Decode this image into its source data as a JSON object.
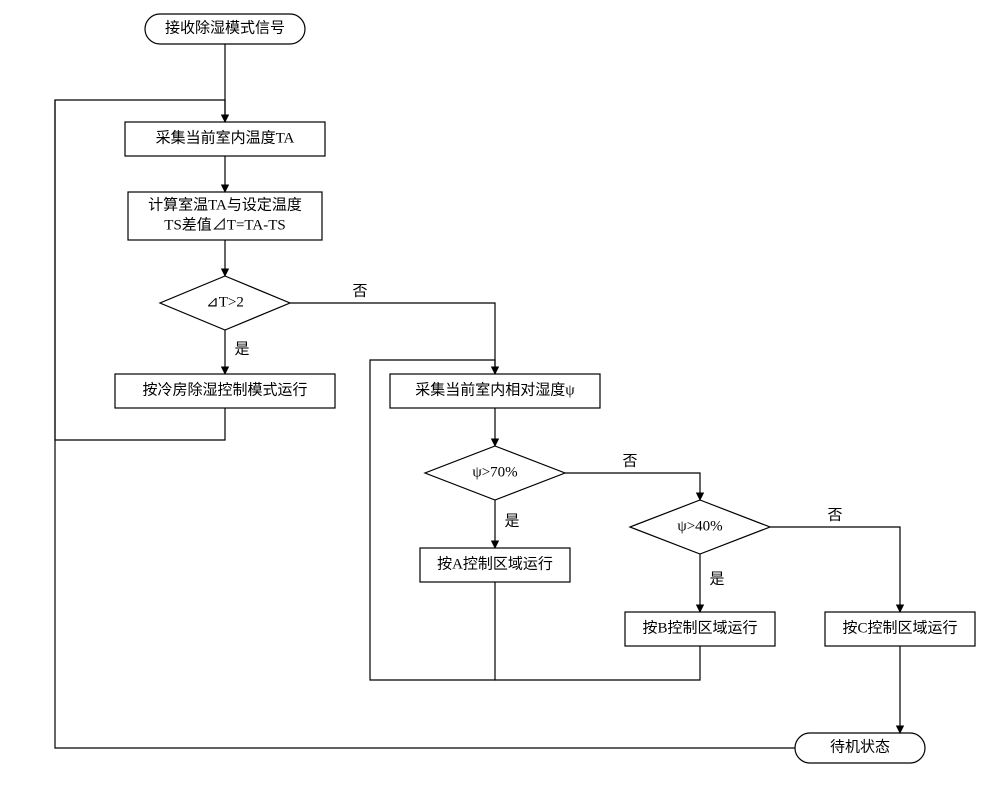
{
  "chart_data": {
    "type": "flowchart",
    "nodes": {
      "start": {
        "kind": "terminator",
        "label": "接收除湿模式信号"
      },
      "p1": {
        "kind": "process",
        "label": "采集当前室内温度TA"
      },
      "p2": {
        "kind": "process",
        "label_line1": "计算室温TA与设定温度",
        "label_line2": "TS差值⊿T=TA-TS"
      },
      "d1": {
        "kind": "decision",
        "label": "⊿T>2"
      },
      "p_cold": {
        "kind": "process",
        "label": "按冷房除湿控制模式运行"
      },
      "p_hum": {
        "kind": "process",
        "label": "采集当前室内相对湿度ψ"
      },
      "d2": {
        "kind": "decision",
        "label": "ψ>70%"
      },
      "pA": {
        "kind": "process",
        "label": "按A控制区域运行"
      },
      "d3": {
        "kind": "decision",
        "label": "ψ>40%"
      },
      "pB": {
        "kind": "process",
        "label": "按B控制区域运行"
      },
      "pC": {
        "kind": "process",
        "label": "按C控制区域运行"
      },
      "standby": {
        "kind": "terminator",
        "label": "待机状态"
      }
    },
    "edge_labels": {
      "yes": "是",
      "no": "否"
    },
    "edges": [
      {
        "from": "start",
        "to": "p1"
      },
      {
        "from": "p1",
        "to": "p2"
      },
      {
        "from": "p2",
        "to": "d1"
      },
      {
        "from": "d1",
        "to": "p_cold",
        "label": "yes"
      },
      {
        "from": "d1",
        "to": "p_hum",
        "label": "no"
      },
      {
        "from": "p_cold",
        "to": "p1",
        "label": "loop_back"
      },
      {
        "from": "p_hum",
        "to": "d2"
      },
      {
        "from": "d2",
        "to": "pA",
        "label": "yes"
      },
      {
        "from": "d2",
        "to": "d3",
        "label": "no"
      },
      {
        "from": "d3",
        "to": "pB",
        "label": "yes"
      },
      {
        "from": "d3",
        "to": "pC",
        "label": "no"
      },
      {
        "from": "pA",
        "to": "p_hum",
        "label": "loop_back"
      },
      {
        "from": "pB",
        "to": "p_hum",
        "label": "loop_back"
      },
      {
        "from": "pC",
        "to": "standby"
      },
      {
        "from": "standby",
        "to": "p1",
        "label": "loop_back"
      }
    ]
  }
}
